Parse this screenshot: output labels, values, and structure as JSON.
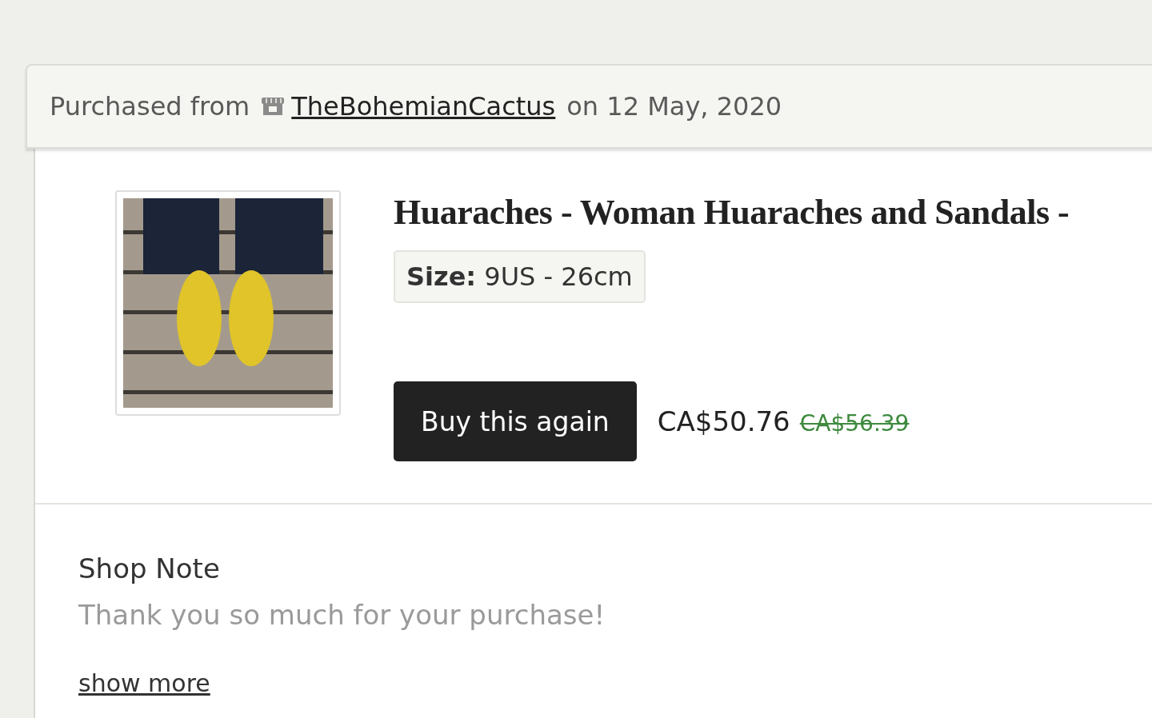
{
  "purchase_header": {
    "prefix": "Purchased from",
    "shop_name": "TheBohemianCactus",
    "date_text": "on 12 May, 2020"
  },
  "item": {
    "title": "Huaraches - Woman Huaraches and Sandals -",
    "variation_label": "Size:",
    "variation_value": "9US - 26cm",
    "buy_again_button": "Buy this again",
    "price": "CA$50.76",
    "original_price": "CA$56.39"
  },
  "shop_note": {
    "heading": "Shop Note",
    "text": "Thank you so much for your purchase!",
    "show_more": "show more"
  }
}
